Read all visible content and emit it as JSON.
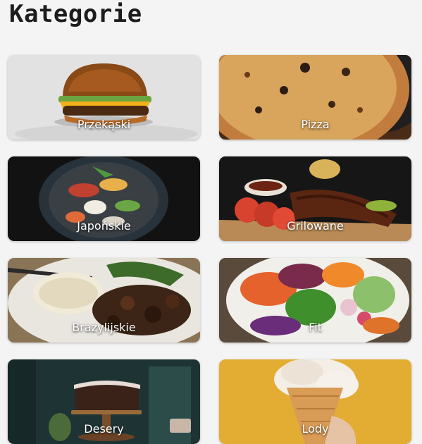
{
  "header": {
    "title": "Kategorie"
  },
  "categories": [
    {
      "label": "Przekąski",
      "icon": "burger-photo"
    },
    {
      "label": "Pizza",
      "icon": "pizza-photo"
    },
    {
      "label": "Japońskie",
      "icon": "sushi-photo"
    },
    {
      "label": "Grilowane",
      "icon": "grilled-ribs-photo"
    },
    {
      "label": "Brazylijskie",
      "icon": "rice-and-beef-photo"
    },
    {
      "label": "Fit",
      "icon": "salad-photo"
    },
    {
      "label": "Desery",
      "icon": "cake-photo"
    },
    {
      "label": "Lody",
      "icon": "ice-cream-photo"
    }
  ]
}
